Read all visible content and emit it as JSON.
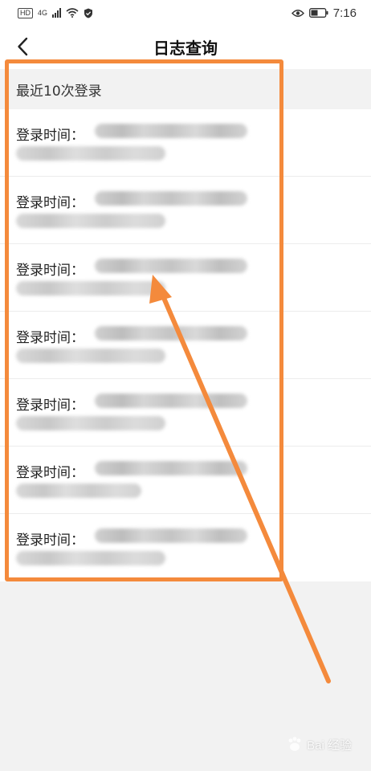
{
  "status_bar": {
    "hd": "HD",
    "network": "4G",
    "time": "7:16"
  },
  "header": {
    "title": "日志查询"
  },
  "section": {
    "title": "最近10次登录"
  },
  "log_entries": [
    {
      "label": "登录时间："
    },
    {
      "label": "登录时间："
    },
    {
      "label": "登录时间："
    },
    {
      "label": "登录时间："
    },
    {
      "label": "登录时间："
    },
    {
      "label": "登录时间："
    },
    {
      "label": "登录时间："
    }
  ],
  "annotation": {
    "color": "#f48a3c"
  },
  "watermark": {
    "text": "Bai 经验"
  },
  "colors": {
    "background": "#f2f2f2",
    "surface": "#ffffff",
    "accent": "#f48a3c"
  }
}
